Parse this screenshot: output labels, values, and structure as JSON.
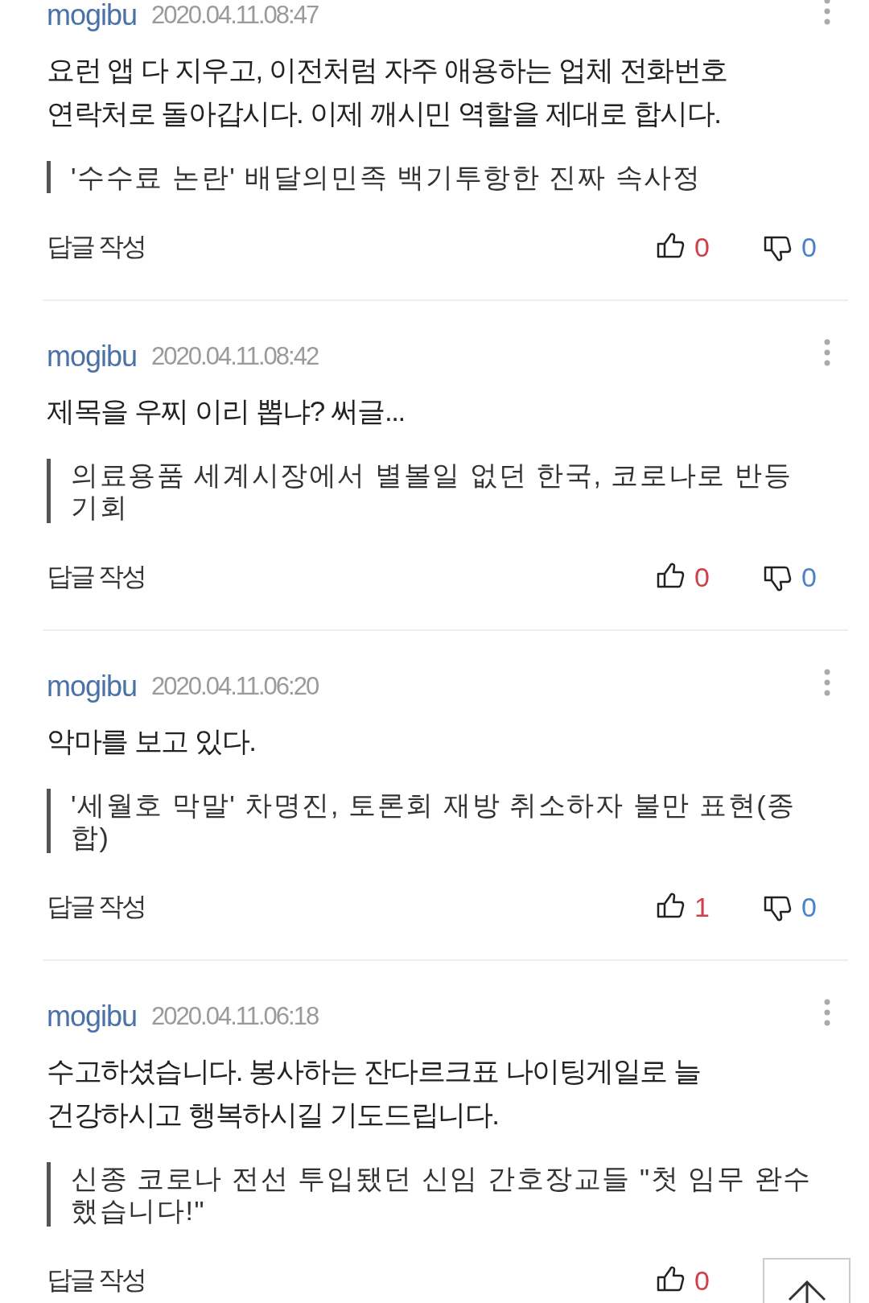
{
  "comments": [
    {
      "user": "mogibu",
      "date": "2020.04.11.08:47",
      "text": "요런 앱 다 지우고, 이전처럼 자주 애용하는 업체 전화번호 연락처로 돌아갑시다. 이제 깨시민 역할을 제대로 합시다.",
      "article": "'수수료 논란' 배달의민족 백기투항한 진짜 속사정",
      "reply": "답글 작성",
      "likes": "0",
      "dislikes": "0"
    },
    {
      "user": "mogibu",
      "date": "2020.04.11.08:42",
      "text": "제목을 우찌 이리 뽑냐? 써글...",
      "article": "의료용품 세계시장에서 별볼일 없던 한국, 코로나로 반등 기회",
      "reply": "답글 작성",
      "likes": "0",
      "dislikes": "0"
    },
    {
      "user": "mogibu",
      "date": "2020.04.11.06:20",
      "text": "악마를 보고 있다.",
      "article": "'세월호 막말' 차명진, 토론회 재방 취소하자 불만 표현(종합)",
      "reply": "답글 작성",
      "likes": "1",
      "dislikes": "0"
    },
    {
      "user": "mogibu",
      "date": "2020.04.11.06:18",
      "text": "수고하셨습니다. 봉사하는 잔다르크표 나이팅게일로 늘 건강하시고 행복하시길 기도드립니다.",
      "article": "신종 코로나 전선 투입됐던 신임 간호장교들 \"첫 임무 완수했습니다!\"",
      "reply": "답글 작성",
      "likes": "0"
    }
  ]
}
